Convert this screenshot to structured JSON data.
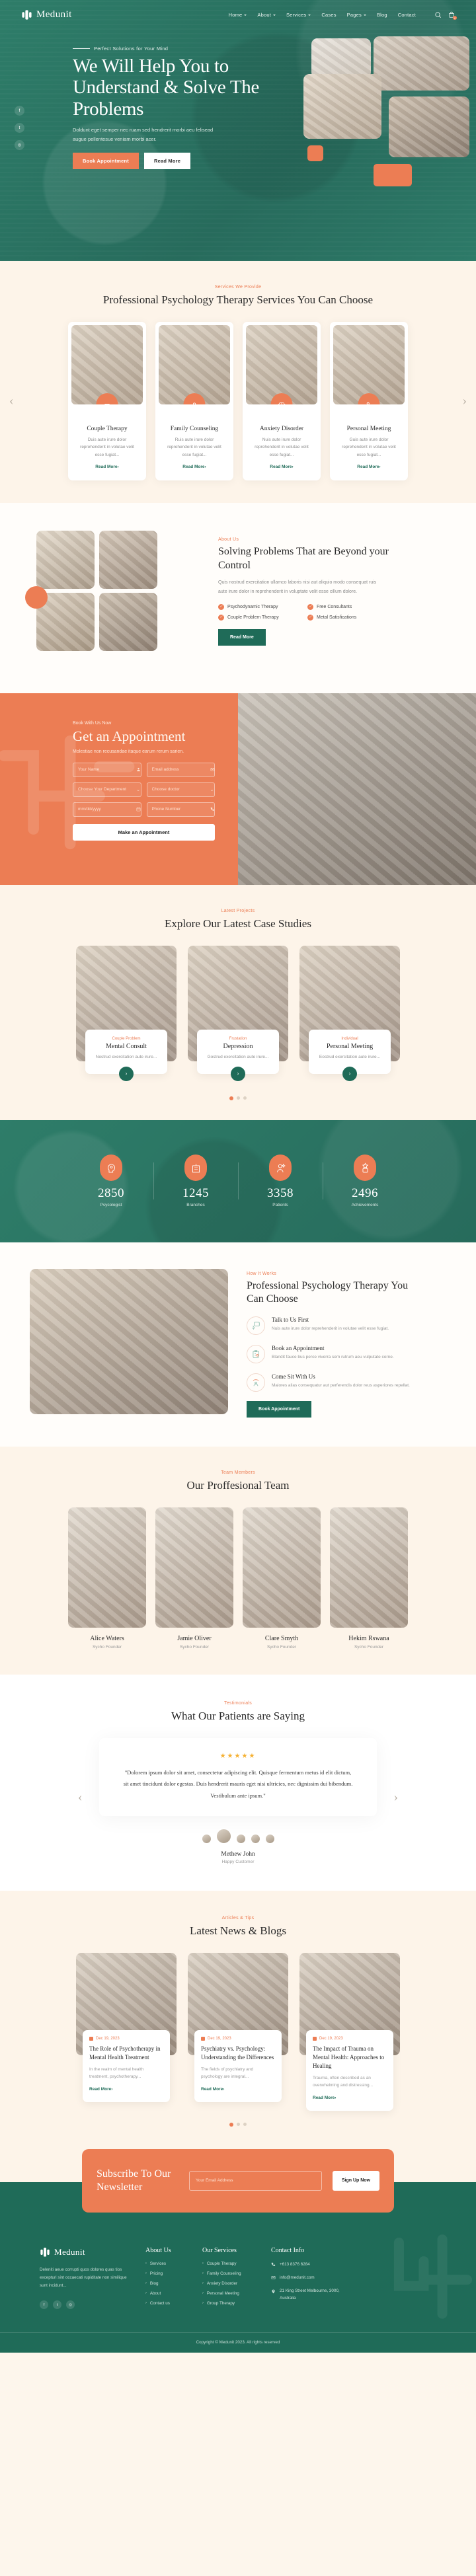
{
  "brand": {
    "name": "Medunit",
    "logo_icon": "medical-cross-icon"
  },
  "nav": {
    "items": [
      {
        "label": "Home",
        "has_dropdown": true
      },
      {
        "label": "About",
        "has_dropdown": true
      },
      {
        "label": "Services",
        "has_dropdown": true
      },
      {
        "label": "Cases",
        "has_dropdown": false
      },
      {
        "label": "Pages",
        "has_dropdown": true
      },
      {
        "label": "Blog",
        "has_dropdown": false
      },
      {
        "label": "Contact",
        "has_dropdown": false
      }
    ],
    "search_icon": "search-icon",
    "cart_icon": "shopping-bag-icon",
    "cart_count": "0"
  },
  "hero": {
    "eyebrow": "Perfect Solutions for Your Mind",
    "title": "We Will Help You to Understand & Solve The Problems",
    "subtitle": "Doldunt eget semper nec ruam sed hendrerit morbi aeu felisead augue pellentesue veniam morbi acer.",
    "primary_btn": "Book Appointment",
    "secondary_btn": "Read More",
    "socials": [
      "facebook-icon",
      "twitter-icon",
      "instagram-icon"
    ]
  },
  "services": {
    "kicker": "Services We Provide",
    "title": "Professional Psychology Therapy Services You Can Choose",
    "read_more": "Read More",
    "cards": [
      {
        "icon": "couple-therapy-icon",
        "name": "Couple Therapy",
        "desc": "Duis aute irure dolor reprehenderit in volutae velit esse fugiat..."
      },
      {
        "icon": "family-hands-icon",
        "name": "Family Counseling",
        "desc": "Ruis aute irure dolor reprehenderit in volutae velit esse fugiat..."
      },
      {
        "icon": "brain-icon",
        "name": "Anxiety Disorder",
        "desc": "Nuis aute irure dolor reprehenderit in volutae velit esse fugiat..."
      },
      {
        "icon": "person-meeting-icon",
        "name": "Personal Meeting",
        "desc": "Guis aute irure dolor reprehenderit in volutae velit esse fugiat..."
      }
    ]
  },
  "about": {
    "kicker": "About Us",
    "title": "Solving Problems That are Beyond your Control",
    "paragraph": "Quis nostrud exercitation ullamco laboris nisi aut aliquio modo consequat ruis aute irure dolor in reprehenderit in voluptate velit esse cillum dolore.",
    "features": [
      "Psychodynamic Therapy",
      "Free Consultants",
      "Couple Problem Therapy",
      "Metal Satisfications"
    ],
    "button": "Read More"
  },
  "appointment": {
    "kicker": "Book With Us Now",
    "title": "Get an Appointment",
    "subtitle": "Molestiae non recusandae itaque earum rerum sarien.",
    "fields": [
      {
        "placeholder": "Your Name",
        "icon": "user-icon",
        "type": "text"
      },
      {
        "placeholder": "Email address",
        "icon": "envelope-icon",
        "type": "text"
      },
      {
        "placeholder": "Choose Your Department",
        "icon": "chevron-down-icon",
        "type": "select"
      },
      {
        "placeholder": "Choose doctor",
        "icon": "chevron-down-icon",
        "type": "select"
      },
      {
        "placeholder": "mm/dd/yyyy",
        "icon": "calendar-icon",
        "type": "date"
      },
      {
        "placeholder": "Phone Number",
        "icon": "phone-icon",
        "type": "text"
      }
    ],
    "submit": "Make an Appointment"
  },
  "cases": {
    "kicker": "Latest Projects",
    "title": "Explore Our Latest Case Studies",
    "items": [
      {
        "category": "Couple Problem",
        "title": "Mental Consult",
        "desc": "Nostrud exercitation aute irure...",
        "arrow": "chevron-right-icon"
      },
      {
        "category": "Frustation",
        "title": "Depression",
        "desc": "Gostrud exercitation aute irure...",
        "arrow": "chevron-right-icon"
      },
      {
        "category": "Individual",
        "title": "Personal Meeting",
        "desc": "Eostrud exercitation aute irure...",
        "arrow": "chevron-right-icon"
      }
    ],
    "dots": 3,
    "active_dot": 1
  },
  "counters": [
    {
      "icon": "head-mind-icon",
      "value": "2850",
      "label": "Psycologist"
    },
    {
      "icon": "building-icon",
      "value": "1245",
      "label": "Branches"
    },
    {
      "icon": "patient-icon",
      "value": "3358",
      "label": "Patients"
    },
    {
      "icon": "award-icon",
      "value": "2496",
      "label": "Achievements"
    }
  ],
  "how": {
    "kicker": "How It Works",
    "title": "Professional Psychology Therapy You Can Choose",
    "steps": [
      {
        "icon": "phone-chat-icon",
        "title": "Talk to Us First",
        "desc": "Nuis aute irure dolor reprehenderit in volutae velit esse fugiat."
      },
      {
        "icon": "clipboard-check-icon",
        "title": "Book an Appointment",
        "desc": "Blandit fauce bus perce viverra sem rutrum aeu vulputate corne."
      },
      {
        "icon": "person-sit-icon",
        "title": "Come Sit With Us",
        "desc": "Maiores alias consequatur aut perferendis dolor reus asperiores repellat."
      }
    ],
    "button": "Book Appointment"
  },
  "team": {
    "kicker": "Team Members",
    "title": "Our Proffesional Team",
    "members": [
      {
        "name": "Alice Waters",
        "role": "Sycho Founder"
      },
      {
        "name": "Jamie Oliver",
        "role": "Sycho Founder"
      },
      {
        "name": "Clare Smyth",
        "role": "Sycho Founder"
      },
      {
        "name": "Hekim Rswana",
        "role": "Sycho Founder"
      }
    ]
  },
  "testimonials": {
    "kicker": "Testimonials",
    "title": "What Our Patients are Saying",
    "rating": 5,
    "stars": "★★★★★",
    "quote": "\"Dolorem ipsum dolor sit amet, consectetur adipiscing elit. Quisque fermentum metus id elit dictum, sit amet tincidunt dolor egestas. Duis hendrerit mauris eget nisi ultricies, nec dignissim dui bibendum. Vestibulum ante ipsum.\"",
    "author": "Methew John",
    "author_role": "Happy Customer",
    "prev_icon": "chevron-left-icon",
    "next_icon": "chevron-right-icon",
    "avatar_count": 5
  },
  "blog": {
    "kicker": "Articles & Tips",
    "title": "Latest News & Blogs",
    "read_more": "Read More",
    "posts": [
      {
        "date": "Dec 19, 2023",
        "title": "The Role of Psychotherapy in Mental Health Treatment",
        "excerpt": "In the realm of mental health treatment, psychotherapy..."
      },
      {
        "date": "Dec 19, 2023",
        "title": "Psychiatry vs. Psychology: Understanding the Differences",
        "excerpt": "The fields of psychiatry and psychology are integral..."
      },
      {
        "date": "Dec 19, 2023",
        "title": "The Impact of Trauma on Mental Health: Approaches to Healing",
        "excerpt": "Trauma, often described as an overwhelming and distressing..."
      }
    ],
    "dots": 3,
    "active_dot": 1
  },
  "newsletter": {
    "title": "Subscribe To Our Newsletter",
    "placeholder": "Your Email Address",
    "button": "Sign Up Now"
  },
  "footer": {
    "about_text": "Deleniti aeue corrupti quos dolores quas tios excepturi sint occaecati rupiditate non similique sunt incidunt...",
    "socials": [
      "facebook-icon",
      "twitter-icon",
      "instagram-icon"
    ],
    "columns": [
      {
        "heading": "About Us",
        "links": [
          "Services",
          "Pricing",
          "Blog",
          "About",
          "Contact us"
        ]
      },
      {
        "heading": "Our Services",
        "links": [
          "Couple Therapy",
          "Family Counseling",
          "Anxiety Disorder",
          "Personal Meeting",
          "Group Therapy"
        ]
      }
    ],
    "contact": {
      "heading": "Contact Info",
      "phone": "+613 8376 6284",
      "email": "info@medunit.com",
      "address": "21 King Street Melbourne, 3000, Australia"
    },
    "copyright": "Copyright © Medunit 2023. All rights reserved"
  },
  "colors": {
    "green": "#1f6b58",
    "green_hero": "#2d7a68",
    "orange": "#ec7d54",
    "cream": "#fdf4e9",
    "star": "#f5b133"
  }
}
